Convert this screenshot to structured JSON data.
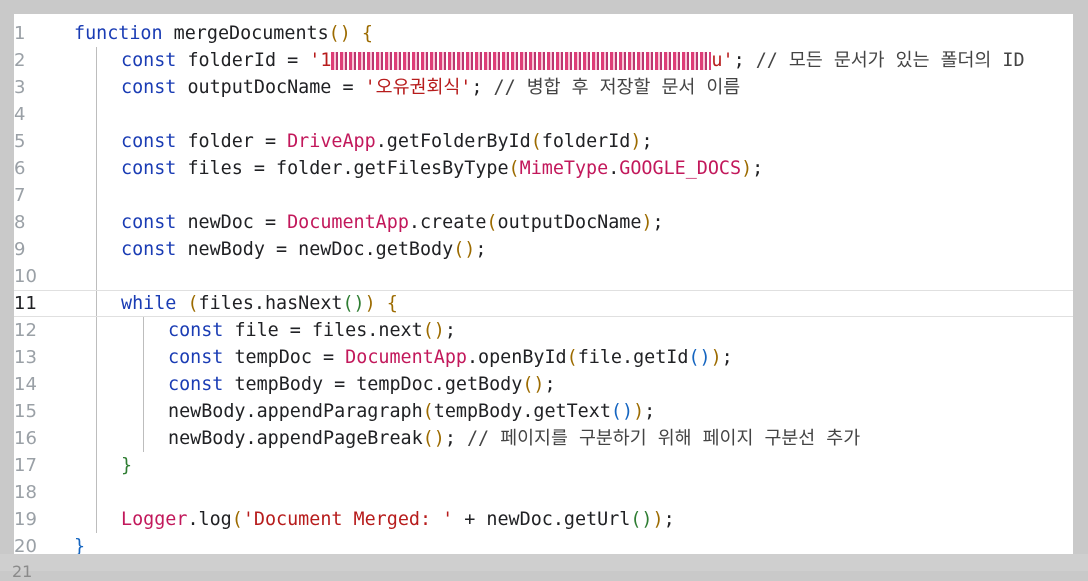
{
  "editor": {
    "last_line_number": "21",
    "lines": [
      {
        "n": "1",
        "parts": [
          {
            "c": "kw",
            "t": "function"
          },
          {
            "c": "",
            "t": " mergeDocuments"
          },
          {
            "c": "p1",
            "t": "()"
          },
          {
            "c": "",
            "t": " "
          },
          {
            "c": "p1",
            "t": "{"
          }
        ]
      },
      {
        "n": "2",
        "indent": 1,
        "parts": [
          {
            "c": "kw",
            "t": "const"
          },
          {
            "c": "",
            "t": " folderId = "
          },
          {
            "c": "str",
            "t": "'1"
          },
          {
            "c": "blur",
            "t": "redacted",
            "w": 380
          },
          {
            "c": "str",
            "t": "u'"
          },
          {
            "c": "",
            "t": "; "
          },
          {
            "c": "cmt",
            "t": "// 모든 문서가 있는 폴더의 ID"
          }
        ]
      },
      {
        "n": "3",
        "indent": 1,
        "parts": [
          {
            "c": "kw",
            "t": "const"
          },
          {
            "c": "",
            "t": " outputDocName = "
          },
          {
            "c": "str",
            "t": "'오유권회식'"
          },
          {
            "c": "",
            "t": "; "
          },
          {
            "c": "cmt",
            "t": "// 병합 후 저장할 문서 이름"
          }
        ]
      },
      {
        "n": "4",
        "indent": 1,
        "parts": []
      },
      {
        "n": "5",
        "indent": 1,
        "parts": [
          {
            "c": "kw",
            "t": "const"
          },
          {
            "c": "",
            "t": " folder = "
          },
          {
            "c": "cls",
            "t": "DriveApp"
          },
          {
            "c": "",
            "t": ".getFolderById"
          },
          {
            "c": "p1",
            "t": "("
          },
          {
            "c": "",
            "t": "folderId"
          },
          {
            "c": "p1",
            "t": ")"
          },
          {
            "c": "",
            "t": ";"
          }
        ]
      },
      {
        "n": "6",
        "indent": 1,
        "parts": [
          {
            "c": "kw",
            "t": "const"
          },
          {
            "c": "",
            "t": " files = folder.getFilesByType"
          },
          {
            "c": "p1",
            "t": "("
          },
          {
            "c": "cls",
            "t": "MimeType"
          },
          {
            "c": "",
            "t": "."
          },
          {
            "c": "cls",
            "t": "GOOGLE_DOCS"
          },
          {
            "c": "p1",
            "t": ")"
          },
          {
            "c": "",
            "t": ";"
          }
        ]
      },
      {
        "n": "7",
        "indent": 1,
        "parts": []
      },
      {
        "n": "8",
        "indent": 1,
        "parts": [
          {
            "c": "kw",
            "t": "const"
          },
          {
            "c": "",
            "t": " newDoc = "
          },
          {
            "c": "cls",
            "t": "DocumentApp"
          },
          {
            "c": "",
            "t": ".create"
          },
          {
            "c": "p1",
            "t": "("
          },
          {
            "c": "",
            "t": "outputDocName"
          },
          {
            "c": "p1",
            "t": ")"
          },
          {
            "c": "",
            "t": ";"
          }
        ]
      },
      {
        "n": "9",
        "indent": 1,
        "parts": [
          {
            "c": "kw",
            "t": "const"
          },
          {
            "c": "",
            "t": " newBody = newDoc.getBody"
          },
          {
            "c": "p1",
            "t": "()"
          },
          {
            "c": "",
            "t": ";"
          }
        ]
      },
      {
        "n": "10",
        "indent": 1,
        "parts": []
      },
      {
        "n": "11",
        "indent": 1,
        "active": true,
        "parts": [
          {
            "c": "kw",
            "t": "while"
          },
          {
            "c": "",
            "t": " "
          },
          {
            "c": "p1",
            "t": "("
          },
          {
            "c": "",
            "t": "files.hasNext"
          },
          {
            "c": "p2",
            "t": "()"
          },
          {
            "c": "p1",
            "t": ")"
          },
          {
            "c": "",
            "t": " "
          },
          {
            "c": "p1",
            "t": "{"
          }
        ]
      },
      {
        "n": "12",
        "indent": 2,
        "parts": [
          {
            "c": "kw",
            "t": "const"
          },
          {
            "c": "",
            "t": " file = files.next"
          },
          {
            "c": "p1",
            "t": "()"
          },
          {
            "c": "",
            "t": ";"
          }
        ]
      },
      {
        "n": "13",
        "indent": 2,
        "parts": [
          {
            "c": "kw",
            "t": "const"
          },
          {
            "c": "",
            "t": " tempDoc = "
          },
          {
            "c": "cls",
            "t": "DocumentApp"
          },
          {
            "c": "",
            "t": ".openById"
          },
          {
            "c": "p1",
            "t": "("
          },
          {
            "c": "",
            "t": "file.getId"
          },
          {
            "c": "p3",
            "t": "()"
          },
          {
            "c": "p1",
            "t": ")"
          },
          {
            "c": "",
            "t": ";"
          }
        ]
      },
      {
        "n": "14",
        "indent": 2,
        "parts": [
          {
            "c": "kw",
            "t": "const"
          },
          {
            "c": "",
            "t": " tempBody = tempDoc.getBody"
          },
          {
            "c": "p1",
            "t": "()"
          },
          {
            "c": "",
            "t": ";"
          }
        ]
      },
      {
        "n": "15",
        "indent": 2,
        "parts": [
          {
            "c": "",
            "t": "newBody.appendParagraph"
          },
          {
            "c": "p1",
            "t": "("
          },
          {
            "c": "",
            "t": "tempBody.getText"
          },
          {
            "c": "p3",
            "t": "()"
          },
          {
            "c": "p1",
            "t": ")"
          },
          {
            "c": "",
            "t": ";"
          }
        ]
      },
      {
        "n": "16",
        "indent": 2,
        "parts": [
          {
            "c": "",
            "t": "newBody.appendPageBreak"
          },
          {
            "c": "p1",
            "t": "()"
          },
          {
            "c": "",
            "t": "; "
          },
          {
            "c": "cmt",
            "t": "// 페이지를 구분하기 위해 페이지 구분선 추가"
          }
        ]
      },
      {
        "n": "17",
        "indent": 1,
        "parts": [
          {
            "c": "p2",
            "t": "}"
          }
        ]
      },
      {
        "n": "18",
        "indent": 1,
        "parts": []
      },
      {
        "n": "19",
        "indent": 1,
        "parts": [
          {
            "c": "cls",
            "t": "Logger"
          },
          {
            "c": "",
            "t": ".log"
          },
          {
            "c": "p1",
            "t": "("
          },
          {
            "c": "str",
            "t": "'Document Merged: '"
          },
          {
            "c": "",
            "t": " + newDoc.getUrl"
          },
          {
            "c": "p2",
            "t": "()"
          },
          {
            "c": "p1",
            "t": ")"
          },
          {
            "c": "",
            "t": ";"
          }
        ]
      },
      {
        "n": "20",
        "parts": [
          {
            "c": "p3",
            "t": "}"
          }
        ]
      }
    ]
  }
}
